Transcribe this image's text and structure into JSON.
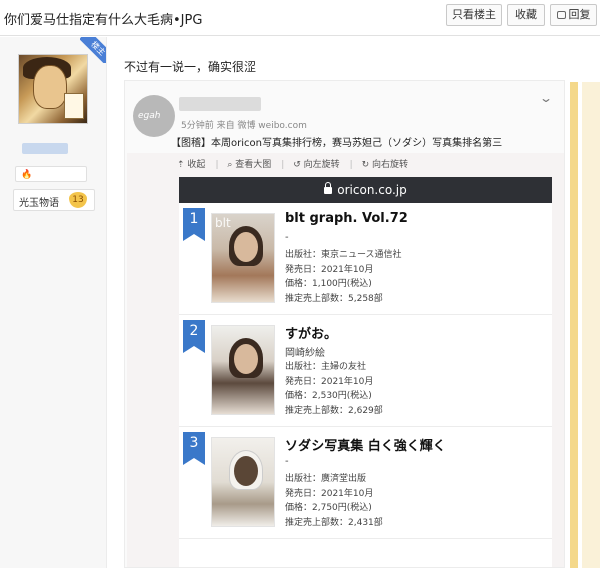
{
  "thread": {
    "title": "你们爱马仕指定有什么大毛病•JPG",
    "buttons": {
      "only_op": "只看楼主",
      "favorite": "收藏",
      "reply": "回复"
    }
  },
  "author": {
    "op_badge": "楼主",
    "badge_name": "光玉物语",
    "level": "13"
  },
  "post": {
    "text": "不过有一说一，确实很涩",
    "embed": {
      "avatar_text": "egah",
      "meta": "5分钟前 来自 微博 weibo.com",
      "text": "【图稽】本周oricon写真集排行榜，赛马苏妲己（ソダシ）写真集排名第三",
      "toolbar": [
        "收起",
        "查看大图",
        "向左旋转",
        "向右旋转"
      ],
      "toolbar_icons": [
        "collapse-icon",
        "zoom-icon",
        "rotate-left-icon",
        "rotate-right-icon"
      ],
      "url": "oricon.co.jp",
      "ranking": [
        {
          "rank": "1",
          "cover_text": "blt",
          "title": "blt graph. Vol.72",
          "subtitle": "-",
          "publisher": "出版社：東京ニュース通信社",
          "release": "発売日：2021年10月",
          "price": "価格：1,100円(税込)",
          "sales": "推定売上部数：5,258部"
        },
        {
          "rank": "2",
          "cover_text": "",
          "title": "すがお。",
          "subtitle": "岡崎紗絵",
          "publisher": "出版社：主婦の友社",
          "release": "発売日：2021年10月",
          "price": "価格：2,530円(税込)",
          "sales": "推定売上部数：2,629部"
        },
        {
          "rank": "3",
          "cover_text": "",
          "title": "ソダシ写真集 白く強く輝く",
          "subtitle": "-",
          "publisher": "出版社：廣済堂出版",
          "release": "発売日：2021年10月",
          "price": "価格：2,750円(税込)",
          "sales": "推定売上部数：2,431部"
        }
      ]
    }
  },
  "colors": {
    "accent": "#3a78c9",
    "url_bar": "#2e3035",
    "level_badge": "#f3c44a"
  }
}
